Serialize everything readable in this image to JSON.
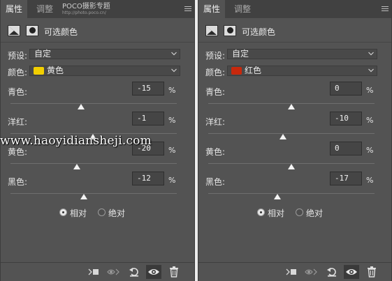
{
  "panels": [
    {
      "tabs": [
        "属性",
        "调整"
      ],
      "watermark": {
        "brand": "POCO摄影专题",
        "url": "http://photo.poco.cn/"
      },
      "title": "可选颜色",
      "preset_label": "预设:",
      "preset_value": "自定",
      "color_label": "颜色:",
      "color_value": "黄色",
      "color_swatch": "#f2cf00",
      "sliders": [
        {
          "label": "青色:",
          "value": "-15",
          "unit": "%",
          "level": -15
        },
        {
          "label": "洋红:",
          "value": "-1",
          "unit": "%",
          "level": -1
        },
        {
          "label": "黄色:",
          "value": "-20",
          "unit": "%",
          "level": -20
        },
        {
          "label": "黑色:",
          "value": "-12",
          "unit": "%",
          "level": -12
        }
      ],
      "method": {
        "relative": "相对",
        "absolute": "绝对",
        "selected": "relative"
      }
    },
    {
      "tabs": [
        "属性",
        "调整"
      ],
      "title": "可选颜色",
      "preset_label": "预设:",
      "preset_value": "自定",
      "color_label": "颜色:",
      "color_value": "红色",
      "color_swatch": "#c8280c",
      "sliders": [
        {
          "label": "青色:",
          "value": "0",
          "unit": "%",
          "level": 0
        },
        {
          "label": "洋红:",
          "value": "-10",
          "unit": "%",
          "level": -10
        },
        {
          "label": "黄色:",
          "value": "0",
          "unit": "%",
          "level": 0
        },
        {
          "label": "黑色:",
          "value": "-17",
          "unit": "%",
          "level": -17
        }
      ],
      "method": {
        "relative": "相对",
        "absolute": "绝对",
        "selected": "relative"
      }
    }
  ],
  "footer_icons": [
    "clip-to-layer-icon",
    "visibility-toggle-icon",
    "reset-icon",
    "eye-icon",
    "trash-icon"
  ],
  "overlay_watermark": "www.haoyidiansheji.com"
}
